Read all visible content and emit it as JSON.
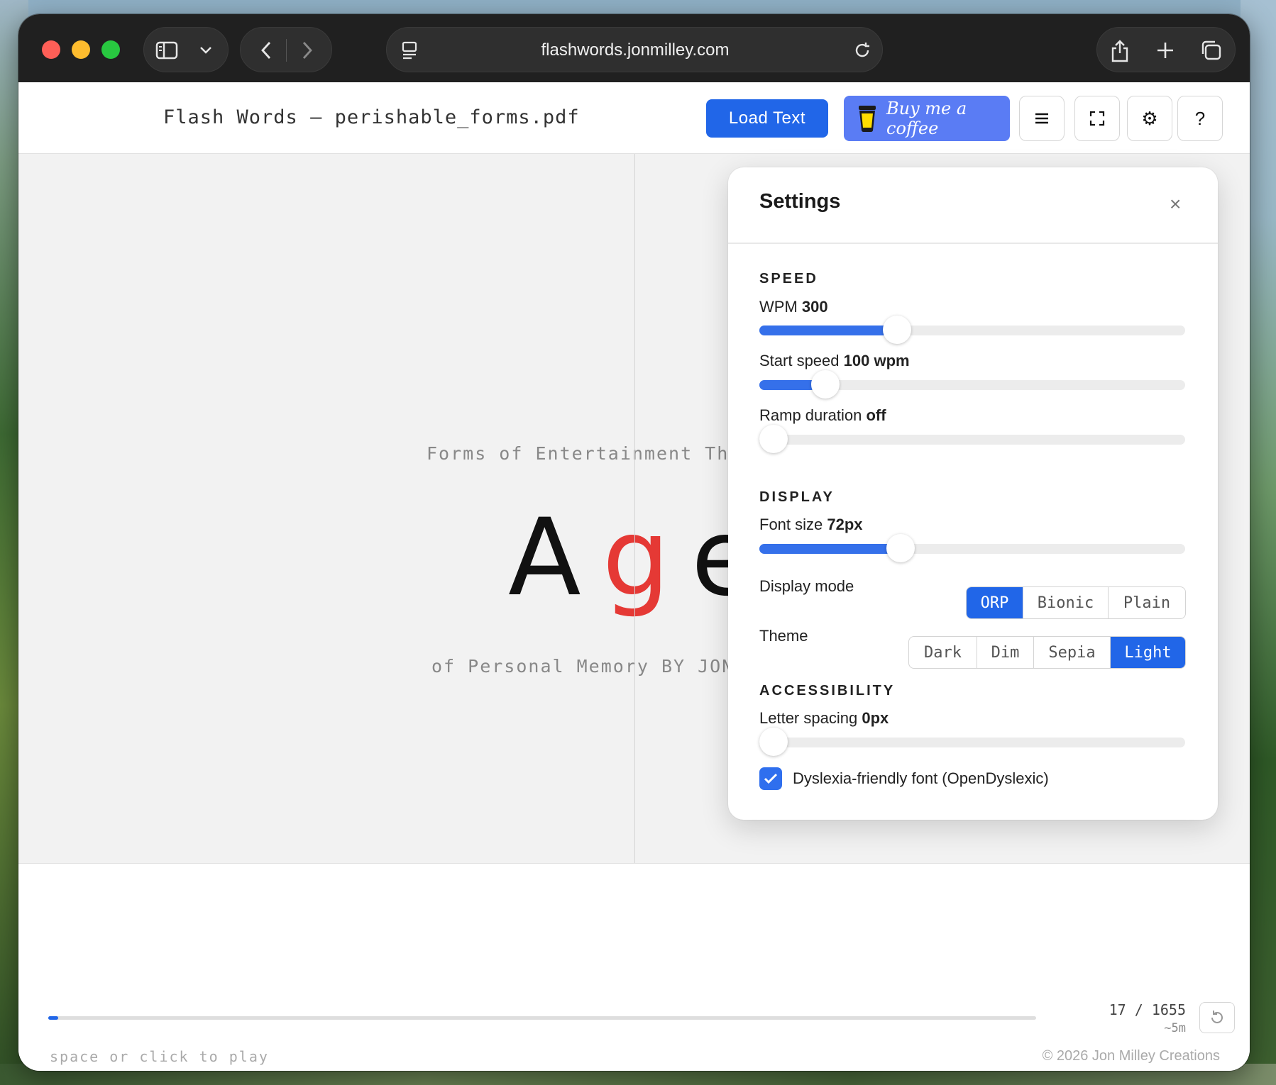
{
  "browser": {
    "url": "flashwords.jonmilley.com"
  },
  "app": {
    "title": "Flash Words – perishable_forms.pdf",
    "load_button": "Load Text",
    "coffee_button": "Buy me a coffee",
    "menu_icon": "hamburger-icon",
    "fullscreen_icon": "fullscreen-icon",
    "settings_icon": "gear-icon",
    "help_label": "?"
  },
  "reader": {
    "context_before": "Forms of Entertainment The C",
    "word_pre": "A",
    "word_orp": "g",
    "word_post": "e",
    "context_after": "of Personal Memory BY JONAT"
  },
  "footer": {
    "progress_fraction": 0.0103,
    "count": "17 / 1655",
    "eta": "~5m",
    "hint": "space or click to play",
    "copyright": "© 2026 Jon Milley Creations"
  },
  "settings": {
    "title": "Settings",
    "close_label": "×",
    "speed_heading": "SPEED",
    "wpm_label": "WPM",
    "wpm_value": "300",
    "wpm_fraction": 0.31,
    "start_label": "Start speed",
    "start_value": "100 wpm",
    "start_fraction": 0.13,
    "ramp_label": "Ramp duration",
    "ramp_value": "off",
    "ramp_fraction": 0.0,
    "display_heading": "DISPLAY",
    "font_label": "Font size",
    "font_value": "72px",
    "font_fraction": 0.32,
    "mode_label": "Display mode",
    "modes": [
      "ORP",
      "Bionic",
      "Plain"
    ],
    "mode_selected": "ORP",
    "theme_label": "Theme",
    "themes": [
      "Dark",
      "Dim",
      "Sepia",
      "Light"
    ],
    "theme_selected": "Light",
    "access_heading": "ACCESSIBILITY",
    "letter_label": "Letter spacing",
    "letter_value": "0px",
    "letter_fraction": 0.0,
    "dyslexia_label": "Dyslexia-friendly font (OpenDyslexic)",
    "dyslexia_checked": true
  },
  "colors": {
    "accent": "#2166e8",
    "orp": "#e53935",
    "coffee": "#5a7cf4"
  }
}
